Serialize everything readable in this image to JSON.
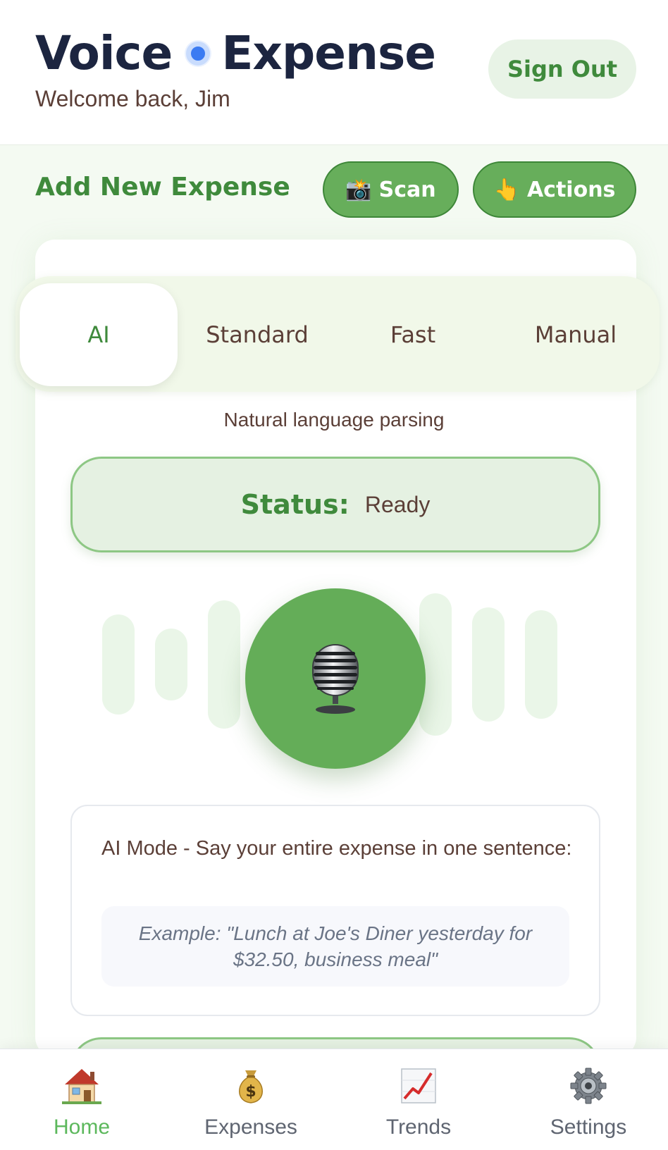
{
  "header": {
    "brand_left": "Voice",
    "brand_right": "Expense",
    "welcome": "Welcome back, Jim",
    "sign_out": "Sign Out"
  },
  "section": {
    "title": "Add New Expense",
    "scan": "Scan",
    "actions": "Actions"
  },
  "modes": {
    "items": [
      "AI",
      "Standard",
      "Fast",
      "Manual"
    ],
    "active": "AI",
    "description": "Natural language parsing"
  },
  "status": {
    "label": "Status:",
    "value": "Ready"
  },
  "hint": {
    "title": "AI Mode - Say your entire expense in one sentence:",
    "example": "Example: \"Lunch at Joe's Diner yesterday for $32.50, business meal\""
  },
  "nav": {
    "items": [
      {
        "label": "Home",
        "icon": "house-icon"
      },
      {
        "label": "Expenses",
        "icon": "money-bag-icon"
      },
      {
        "label": "Trends",
        "icon": "chart-increasing-icon"
      },
      {
        "label": "Settings",
        "icon": "gear-icon"
      }
    ],
    "active": "Home"
  },
  "colors": {
    "accent_green": "#3f8a3c",
    "button_green": "#67ae5b",
    "brand_navy": "#1c2540",
    "brand_dot": "#3b7bf2",
    "active_nav": "#5cb85c"
  }
}
